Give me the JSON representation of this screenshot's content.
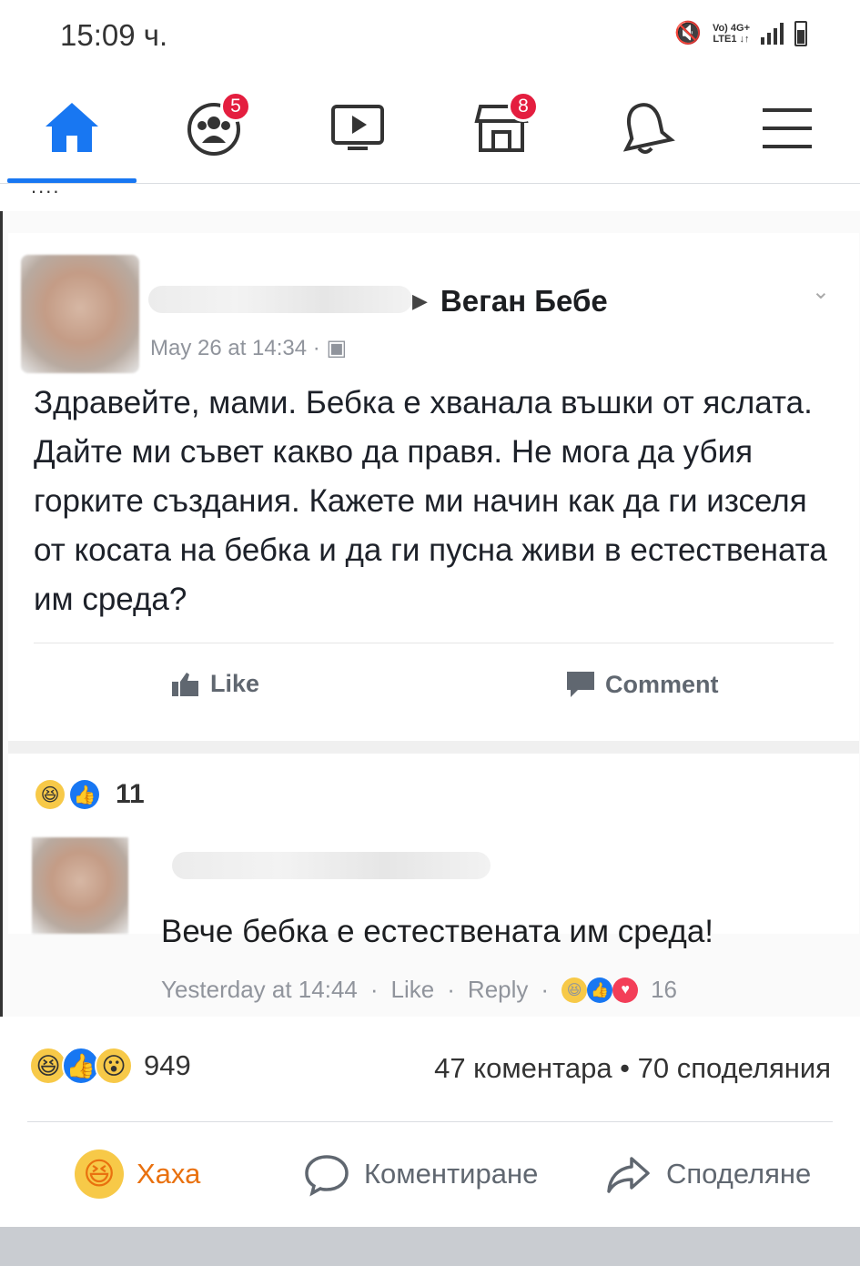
{
  "status": {
    "time": "15:09 ч.",
    "volte": "Vo) 4G+\nLTE1"
  },
  "nav": {
    "items": [
      {
        "name": "home",
        "active": true
      },
      {
        "name": "groups",
        "badge": "5"
      },
      {
        "name": "watch"
      },
      {
        "name": "marketplace",
        "badge": "8"
      },
      {
        "name": "notifications"
      },
      {
        "name": "menu"
      }
    ],
    "dots": "....",
    "accent_color": "#1877f2",
    "badge_color": "#e41e3f"
  },
  "embedded_post": {
    "group_name": "Веган Бебе",
    "meta": "May 26 at 14:34 ·",
    "text": "Здравейте, мами. Бебка е хванала въшки от яслата. Дайте ми съвет какво да правя. Не мога да убия горките създания. Кажете ми начин как да ги изселя от косата на бебка и да ги пусна живи в естествената им среда?",
    "like_label": "Like",
    "comment_label": "Comment",
    "reaction_count": "11",
    "comment": {
      "text": "Вече бебка е естествената им среда!",
      "time": "Yesterday at 14:44",
      "like": "Like",
      "reply": "Reply",
      "reaction_count": "16"
    }
  },
  "footer": {
    "reaction_count": "949",
    "stats": "47 коментара • 70 споделяния",
    "actions": {
      "haha": "Хаха",
      "comment": "Коментиране",
      "share": "Споделяне"
    }
  }
}
